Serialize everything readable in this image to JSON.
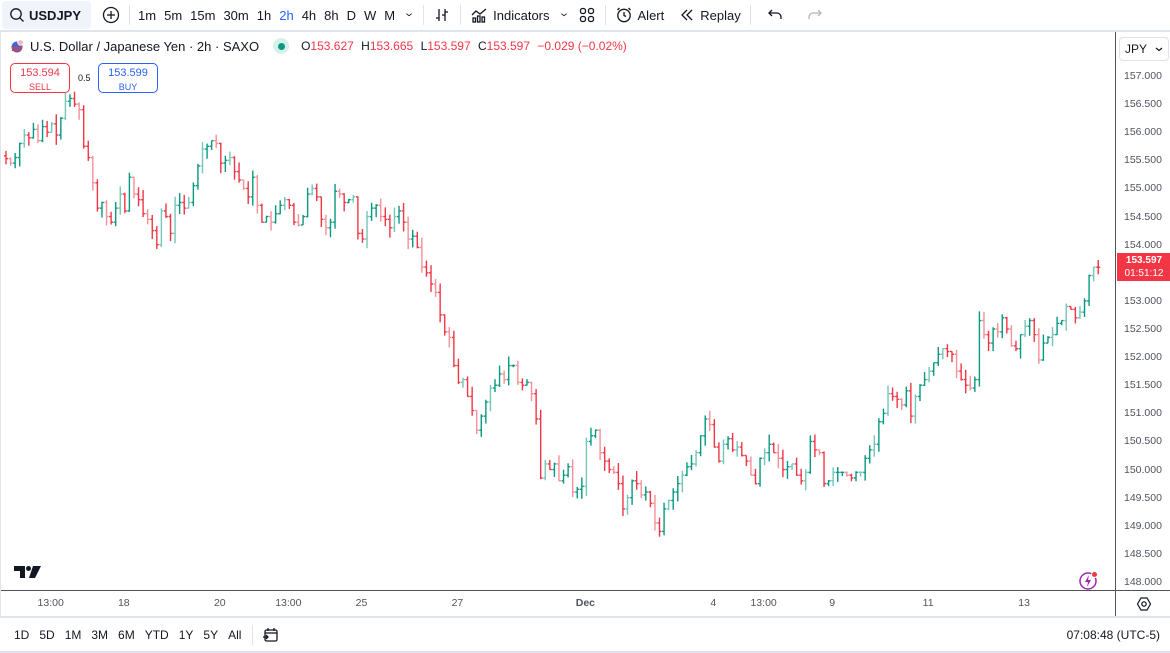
{
  "toolbar": {
    "symbol": "USDJPY",
    "intervals": [
      "1m",
      "5m",
      "15m",
      "30m",
      "1h",
      "2h",
      "4h",
      "8h",
      "D",
      "W",
      "M"
    ],
    "active_interval": "2h",
    "indicators_label": "Indicators",
    "alert_label": "Alert",
    "replay_label": "Replay",
    "icons": [
      "search-icon",
      "add-symbol-icon",
      "chevron-down-icon",
      "bar-style-icon",
      "indicators-icon",
      "layout-icon",
      "alert-clock-icon",
      "replay-icon",
      "undo-icon",
      "redo-icon"
    ]
  },
  "legend": {
    "title": "U.S. Dollar / Japanese Yen · 2h · SAXO",
    "market_status_color": "#089981",
    "open_key": "O",
    "open": "153.627",
    "high_key": "H",
    "high": "153.665",
    "low_key": "L",
    "low": "153.597",
    "close_key": "C",
    "close": "153.597",
    "change": "−0.029 (−0.02%)"
  },
  "trade": {
    "sell_price": "153.594",
    "sell_label": "SELL",
    "buy_price": "153.599",
    "buy_label": "BUY",
    "spread": "0.5"
  },
  "price_scale": {
    "currency": "JPY",
    "current_price": "153.597",
    "countdown": "01:51:12"
  },
  "bottom": {
    "ranges": [
      "1D",
      "5D",
      "1M",
      "3M",
      "6M",
      "YTD",
      "1Y",
      "5Y",
      "All"
    ],
    "clock": "07:08:48 (UTC-5)"
  },
  "colors": {
    "up": "#089981",
    "down": "#f23645",
    "accent": "#2962ff"
  },
  "chart_data": {
    "type": "ohlc",
    "title": "U.S. Dollar / Japanese Yen · 2h · SAXO",
    "ylabel": "JPY",
    "ylim": [
      148.0,
      157.0
    ],
    "yticks": [
      "157.000",
      "156.500",
      "156.000",
      "155.500",
      "155.000",
      "154.500",
      "154.000",
      "153.500",
      "153.000",
      "152.500",
      "152.000",
      "151.500",
      "151.000",
      "150.500",
      "150.000",
      "149.500",
      "149.000",
      "148.500",
      "148.000"
    ],
    "xticks": [
      {
        "label": "13:00",
        "bar": 10
      },
      {
        "label": "18",
        "bar": 26
      },
      {
        "label": "20",
        "bar": 47
      },
      {
        "label": "13:00",
        "bar": 62
      },
      {
        "label": "25",
        "bar": 78
      },
      {
        "label": "27",
        "bar": 99
      },
      {
        "label": "Dec",
        "bar": 127
      },
      {
        "label": "4",
        "bar": 155
      },
      {
        "label": "13:00",
        "bar": 166
      },
      {
        "label": "9",
        "bar": 181
      },
      {
        "label": "11",
        "bar": 202
      },
      {
        "label": "13",
        "bar": 223
      }
    ],
    "closes": [
      155.53,
      155.45,
      155.55,
      155.8,
      155.95,
      155.9,
      156.05,
      155.85,
      156.1,
      156.0,
      156.15,
      155.95,
      156.25,
      156.55,
      156.6,
      156.5,
      156.4,
      155.75,
      155.55,
      155.1,
      154.65,
      154.75,
      154.5,
      154.4,
      154.65,
      154.9,
      154.6,
      155.2,
      154.9,
      154.8,
      154.55,
      154.45,
      154.25,
      154.0,
      154.6,
      154.5,
      154.2,
      154.7,
      154.75,
      154.65,
      154.75,
      155.05,
      155.4,
      155.7,
      155.75,
      155.85,
      155.8,
      155.45,
      155.5,
      155.55,
      155.3,
      155.15,
      155.0,
      154.85,
      155.2,
      154.7,
      154.4,
      154.5,
      154.4,
      154.55,
      154.7,
      154.8,
      154.7,
      154.4,
      154.35,
      154.5,
      154.9,
      155.0,
      154.85,
      154.45,
      154.3,
      154.4,
      154.95,
      154.9,
      154.75,
      154.8,
      154.85,
      154.2,
      154.1,
      154.5,
      154.65,
      154.7,
      154.5,
      154.45,
      154.3,
      154.5,
      154.6,
      154.4,
      154.1,
      154.15,
      153.95,
      153.6,
      153.5,
      153.3,
      153.15,
      152.75,
      152.45,
      152.35,
      151.85,
      151.55,
      151.6,
      151.3,
      151.05,
      150.7,
      150.95,
      151.2,
      151.45,
      151.5,
      151.7,
      151.6,
      151.85,
      151.85,
      151.55,
      151.5,
      151.55,
      151.35,
      150.9,
      149.85,
      150.1,
      150.0,
      150.1,
      149.8,
      149.9,
      150.05,
      149.6,
      149.65,
      149.7,
      150.5,
      150.6,
      150.7,
      150.3,
      150.15,
      150.0,
      149.95,
      149.75,
      149.3,
      149.5,
      149.8,
      149.75,
      149.55,
      149.6,
      149.4,
      149.05,
      148.9,
      149.3,
      149.45,
      149.6,
      149.75,
      149.9,
      150.05,
      150.1,
      150.3,
      150.6,
      150.9,
      150.8,
      150.4,
      150.15,
      150.45,
      150.55,
      150.35,
      150.4,
      150.25,
      150.15,
      149.9,
      149.75,
      150.2,
      150.3,
      150.45,
      150.3,
      150.2,
      150.0,
      150.05,
      150.1,
      149.9,
      149.8,
      149.95,
      150.5,
      150.35,
      150.3,
      149.75,
      149.8,
      149.95,
      149.95,
      149.95,
      149.9,
      149.85,
      149.95,
      149.95,
      150.2,
      150.35,
      150.45,
      150.85,
      151.0,
      151.35,
      151.3,
      151.25,
      151.15,
      151.4,
      150.95,
      151.3,
      151.5,
      151.6,
      151.75,
      151.9,
      152.05,
      152.15,
      152.1,
      152.05,
      151.75,
      151.6,
      151.5,
      151.45,
      151.6,
      152.65,
      152.4,
      152.25,
      152.5,
      152.45,
      152.7,
      152.5,
      152.2,
      152.15,
      152.4,
      152.55,
      152.65,
      152.4,
      151.95,
      152.25,
      152.35,
      152.4,
      152.6,
      152.65,
      152.9,
      152.85,
      152.7,
      152.8,
      153.0,
      153.45,
      153.6,
      153.597
    ]
  }
}
